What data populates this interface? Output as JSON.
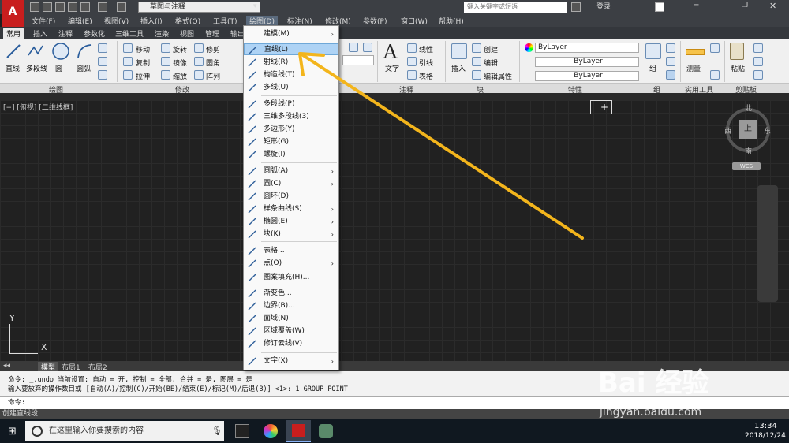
{
  "app": {
    "workspace": "草图与注释",
    "search_placeholder": "键入关键字或短语",
    "login": "登录",
    "logo": "A",
    "title_icon": "autocad-logo",
    "accent": "#c81e1e"
  },
  "menubar": [
    "文件(F)",
    "编辑(E)",
    "视图(V)",
    "插入(I)",
    "格式(O)",
    "工具(T)",
    "绘图(D)",
    "标注(N)",
    "修改(M)",
    "参数(P)",
    "窗口(W)",
    "帮助(H)"
  ],
  "tabs": [
    "常用",
    "插入",
    "注释",
    "参数化",
    "三维工具",
    "渲染",
    "视图",
    "管理",
    "输出"
  ],
  "ribbon": {
    "draw": {
      "line": "直线",
      "polyline": "多段线",
      "circle": "圆",
      "arc": "圆弧"
    },
    "modify": {
      "move": "移动",
      "rotate": "旋转",
      "trim": "修剪",
      "copy": "复制",
      "mirror": "镜像",
      "fillet": "圆角",
      "stretch": "拉伸",
      "scale": "缩放",
      "array": "阵列"
    },
    "annotation": {
      "text": "文字",
      "linear": "线性",
      "leader": "引线",
      "table": "表格"
    },
    "block": {
      "insert": "插入",
      "create": "创建",
      "edit": "编辑",
      "edit_attr": "编辑属性"
    },
    "properties": {
      "color": "ByLayer",
      "linetype": "ByLayer",
      "lineweight": "ByLayer"
    },
    "groups": {
      "group": "组"
    },
    "utilities": {
      "measure": "测量"
    },
    "clipboard": {
      "paste": "粘贴"
    },
    "panel_titles": {
      "draw": "绘图",
      "modify": "修改",
      "annotation": "注释",
      "block": "块",
      "properties": "特性",
      "groups": "组",
      "utilities": "实用工具",
      "clipboard": "剪贴板"
    }
  },
  "viewport": {
    "label": "[−] [俯视] [二维线框]",
    "compass": {
      "n": "北",
      "s": "南",
      "e": "东",
      "w": "西",
      "top": "上",
      "wcs": "WCS"
    },
    "ucs": {
      "x": "X",
      "y": "Y"
    }
  },
  "layout_tabs": [
    "模型",
    "布局1",
    "布局2"
  ],
  "command": {
    "line1": "命令: _.undo 当前设置: 自动 = 开, 控制 = 全部, 合并 = 是, 图层 = 是",
    "line2": "输入要放弃的操作数目或 [自动(A)/控制(C)/开始(BE)/结束(E)/标记(M)/后退(B)] <1>: 1 GROUP POINT",
    "prompt": "命令:"
  },
  "status": "创建直线段",
  "draw_menu": {
    "items": [
      {
        "label": "建模(M)",
        "arrow": true
      },
      {
        "label": "直线(L)",
        "highlight": true
      },
      {
        "label": "射线(R)"
      },
      {
        "label": "构造线(T)"
      },
      {
        "label": "多线(U)"
      },
      {
        "label": "多段线(P)"
      },
      {
        "label": "三维多段线(3)"
      },
      {
        "label": "多边形(Y)"
      },
      {
        "label": "矩形(G)"
      },
      {
        "label": "螺旋(I)"
      },
      {
        "label": "圆弧(A)",
        "arrow": true
      },
      {
        "label": "圆(C)",
        "arrow": true
      },
      {
        "label": "圆环(D)"
      },
      {
        "label": "样条曲线(S)",
        "arrow": true
      },
      {
        "label": "椭圆(E)",
        "arrow": true
      },
      {
        "label": "块(K)",
        "arrow": true
      },
      {
        "label": "表格..."
      },
      {
        "label": "点(O)",
        "arrow": true
      },
      {
        "label": "图案填充(H)..."
      },
      {
        "label": "渐变色..."
      },
      {
        "label": "边界(B)..."
      },
      {
        "label": "面域(N)"
      },
      {
        "label": "区域覆盖(W)"
      },
      {
        "label": "修订云线(V)"
      },
      {
        "label": "文字(X)",
        "arrow": true
      }
    ],
    "arrow_glyph": "›"
  },
  "taskbar": {
    "search": "在这里输入你要搜索的内容",
    "time": "13:34",
    "date": "2018/12/24"
  },
  "watermark": {
    "text": "Bai 经验",
    "url": "jingyan.baidu.com"
  },
  "colors": {
    "annotation_arrow": "#f3b51c",
    "highlight": "#aed3f5"
  }
}
